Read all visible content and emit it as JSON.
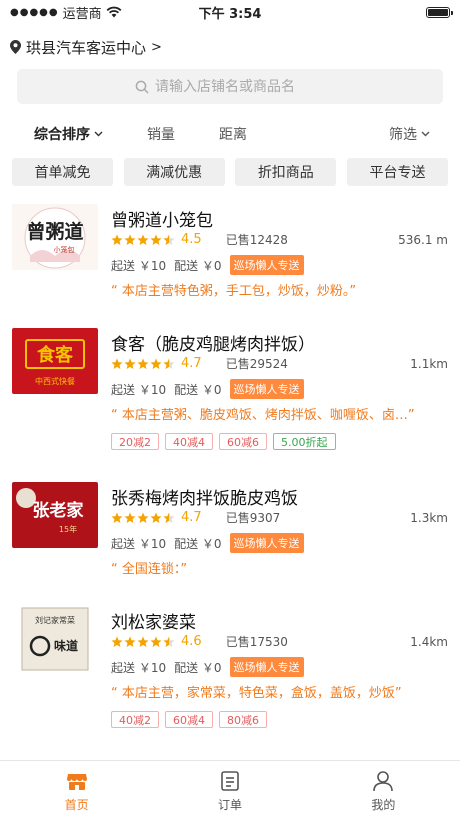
{
  "status_bar": {
    "carrier": "运营商",
    "time": "下午 3:54"
  },
  "location": {
    "name": "珙县汽车客运中心",
    "chevron": ">"
  },
  "search": {
    "placeholder": "请输入店铺名或商品名"
  },
  "sort": {
    "items": [
      "综合排序",
      "销量",
      "距离"
    ],
    "filter": "筛选"
  },
  "tags": [
    "首单减免",
    "满减优惠",
    "折扣商品",
    "平台专送"
  ],
  "colors": {
    "accent": "#f07b1d",
    "badge": "#ff8a3d",
    "star": "#f4a300"
  },
  "shops": [
    {
      "name": "曾粥道小笼包",
      "rating": "4.5",
      "stars": 4.5,
      "sold": "已售12428",
      "distance": "536.1 m",
      "min_order": "起送 ￥10",
      "delivery_fee": "配送 ￥0",
      "badge": "巡场懒人专送",
      "description": "“ 本店主营特色粥，手工包，炒饭，炒粉。”",
      "logo": {
        "text_main": "曾粥道",
        "text_sub": "小笼包"
      },
      "promos": []
    },
    {
      "name": "食客（脆皮鸡腿烤肉拌饭）",
      "rating": "4.7",
      "stars": 4.5,
      "sold": "已售29524",
      "distance": "1.1km",
      "min_order": "起送 ￥10",
      "delivery_fee": "配送 ￥0",
      "badge": "巡场懒人专送",
      "description": "“ 本店主营粥、脆皮鸡饭、烤肉拌饭、咖喱饭、卤…”",
      "logo": {
        "text_main": "食客",
        "text_sub": "中西式快餐"
      },
      "promos": [
        {
          "label": "20减2",
          "style": "red"
        },
        {
          "label": "40减4",
          "style": "red"
        },
        {
          "label": "60减6",
          "style": "red"
        },
        {
          "label": "5.00折起",
          "style": "green"
        }
      ]
    },
    {
      "name": "张秀梅烤肉拌饭脆皮鸡饭",
      "rating": "4.7",
      "stars": 4.5,
      "sold": "已售9307",
      "distance": "1.3km",
      "min_order": "起送 ￥10",
      "delivery_fee": "配送 ￥0",
      "badge": "巡场懒人专送",
      "description": "“ 全国连锁：”",
      "logo": {
        "text_main": "张老家",
        "text_sub": "15年"
      },
      "promos": []
    },
    {
      "name": "刘松家婆菜",
      "rating": "4.6",
      "stars": 4.5,
      "sold": "已售17530",
      "distance": "1.4km",
      "min_order": "起送 ￥10",
      "delivery_fee": "配送 ￥0",
      "badge": "巡场懒人专送",
      "description": "“ 本店主营，家常菜，特色菜，盒饭，盖饭，炒饭”",
      "logo": {
        "text_main": "刘记家常菜",
        "text_sub": "味道"
      },
      "promos": [
        {
          "label": "40减2",
          "style": "red"
        },
        {
          "label": "60减4",
          "style": "red"
        },
        {
          "label": "80减6",
          "style": "red"
        }
      ]
    }
  ],
  "tabbar": [
    {
      "label": "首页",
      "icon": "shop-icon",
      "active": true
    },
    {
      "label": "订单",
      "icon": "order-list-icon",
      "active": false
    },
    {
      "label": "我的",
      "icon": "user-icon",
      "active": false
    }
  ]
}
